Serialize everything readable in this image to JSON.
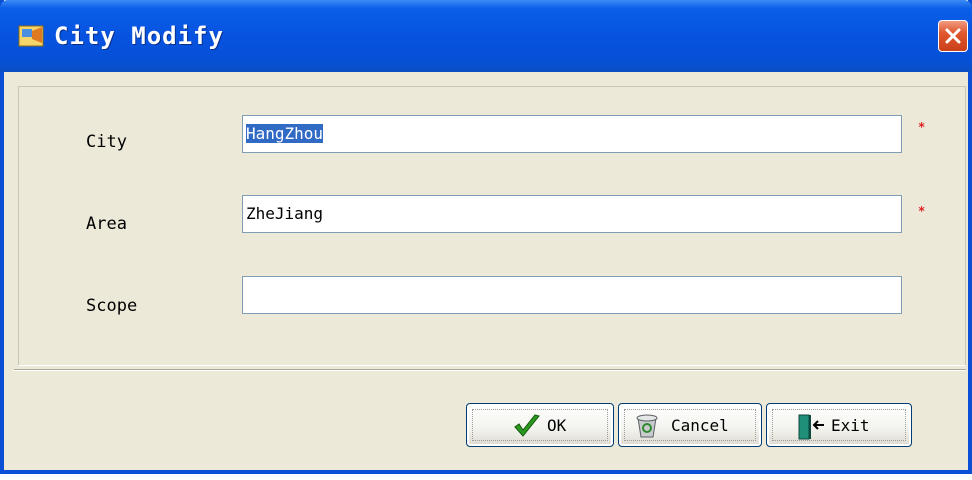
{
  "window": {
    "title": "City Modify"
  },
  "form": {
    "fields": [
      {
        "label": "City",
        "value": "HangZhou",
        "required_mark": "*"
      },
      {
        "label": "Area",
        "value": "ZheJiang",
        "required_mark": "*"
      },
      {
        "label": "Scope",
        "value": ""
      }
    ]
  },
  "buttons": {
    "ok": "OK",
    "cancel": "Cancel",
    "exit": "Exit"
  },
  "colors": {
    "titlebar": "#0753e0",
    "close": "#e0582e",
    "required": "#e02020",
    "selection": "#316ac5",
    "ok_check": "#2a9a1f",
    "exit_door": "#1f8f7a"
  },
  "icons": [
    "app-icon",
    "close-icon",
    "check-icon",
    "recycle-bin-icon",
    "exit-door-icon"
  ]
}
